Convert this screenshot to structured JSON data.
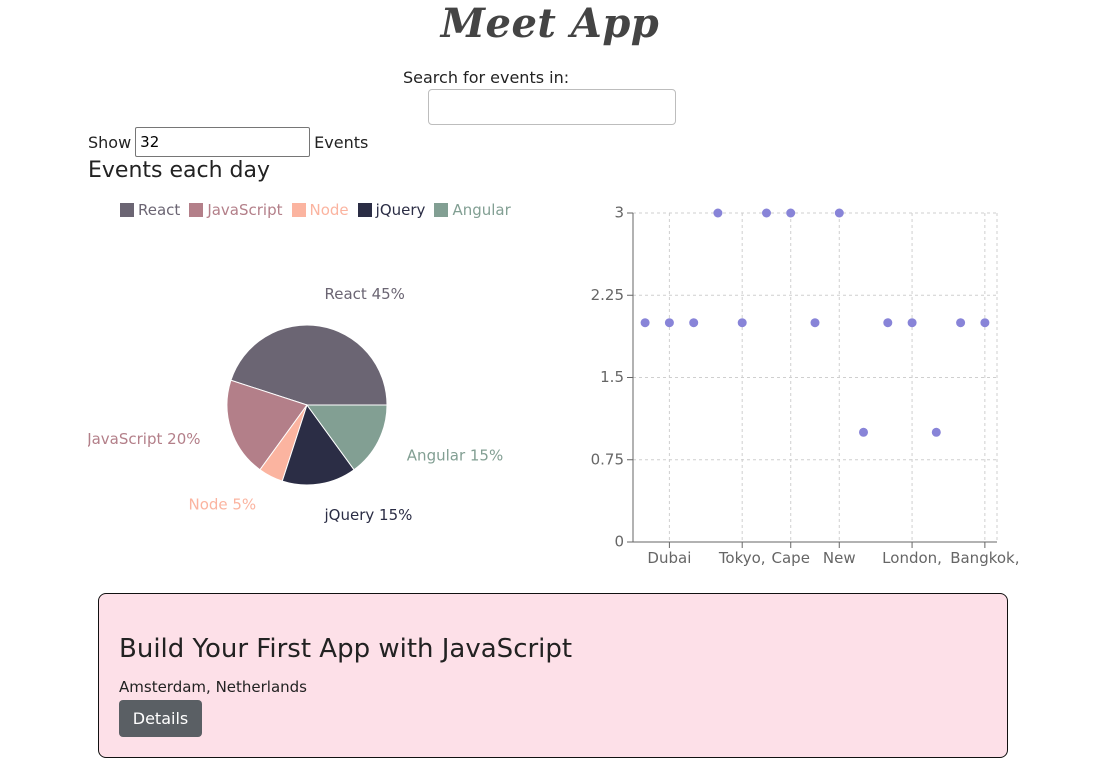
{
  "app": {
    "title": "Meet App"
  },
  "search": {
    "label": "Search for events in:",
    "value": "",
    "placeholder": ""
  },
  "number_of_events": {
    "prefix": "Show",
    "value": "32",
    "suffix": "Events"
  },
  "section": {
    "title": "Events each day"
  },
  "colors": {
    "react": "#6b6573",
    "javascript": "#b37f89",
    "node": "#fbb4a0",
    "jquery": "#2b2d45",
    "angular": "#829f93",
    "scatter_point": "#8884d8",
    "card_background": "#fde0e8",
    "button_background": "#5a5f64"
  },
  "chart_data": [
    {
      "type": "pie",
      "categories": [
        "React",
        "JavaScript",
        "Node",
        "jQuery",
        "Angular"
      ],
      "values": [
        45,
        20,
        5,
        15,
        15
      ],
      "slice_labels": [
        "React 45%",
        "JavaScript 20%",
        "Node 5%",
        "jQuery 15%",
        "Angular 15%"
      ],
      "colors": [
        "#6b6573",
        "#b37f89",
        "#fbb4a0",
        "#2b2d45",
        "#829f93"
      ],
      "legend": [
        "React",
        "JavaScript",
        "Node",
        "jQuery",
        "Angular"
      ],
      "legend_position": "top"
    },
    {
      "type": "scatter",
      "x": [
        "Dubai",
        "Dubai",
        "Dubai",
        "Tokyo,",
        "Tokyo,",
        "Cape",
        "Cape",
        "New",
        "New",
        "New",
        "London,",
        "London,",
        "London,",
        "Bangkok,",
        "Bangkok,"
      ],
      "y": [
        2,
        2,
        2,
        3,
        2,
        3,
        3,
        2,
        3,
        1,
        2,
        2,
        1,
        2,
        2
      ],
      "visible_tick_labels": [
        "Dubai",
        "Tokyo,",
        "Cape",
        "New",
        "London,",
        "Bangkok,"
      ],
      "ylim": [
        0,
        3
      ],
      "yticks": [
        "0",
        "0.75",
        "1.5",
        "2.25",
        "3"
      ],
      "grid": true,
      "xlabel": "",
      "ylabel": ""
    }
  ],
  "events": [
    {
      "title": "Build Your First App with JavaScript",
      "location": "Amsterdam, Netherlands",
      "button_label": "Details"
    }
  ]
}
